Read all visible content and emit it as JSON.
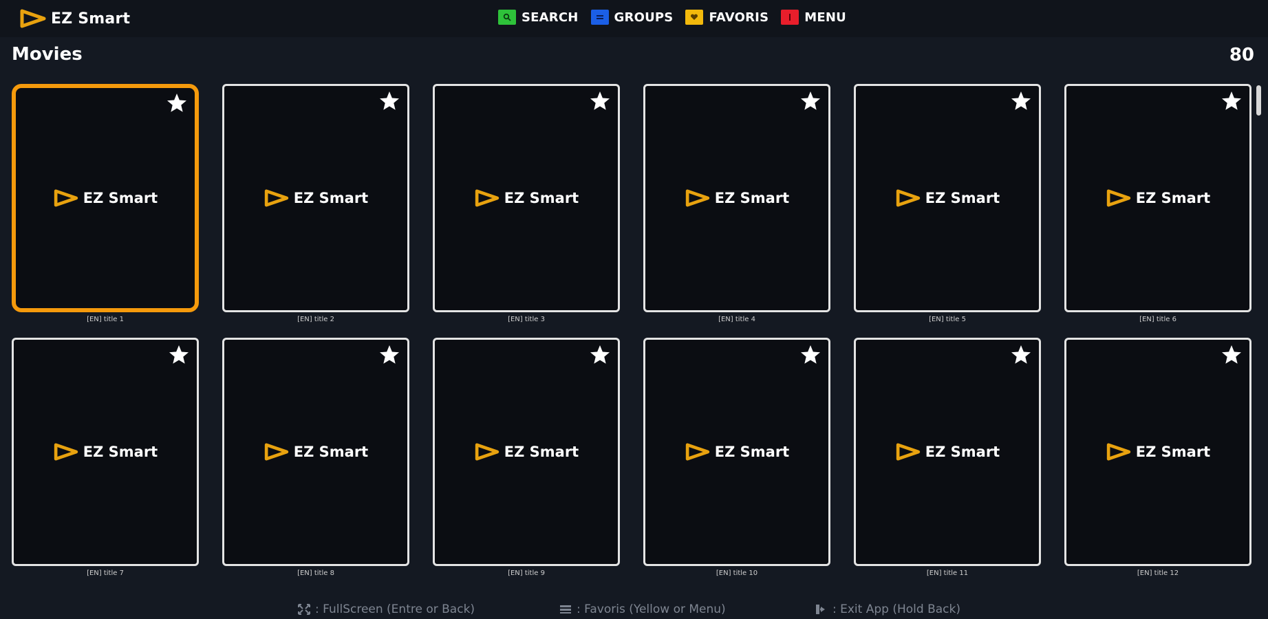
{
  "app": {
    "logo_text": "EZ Smart",
    "accent_color": "#f59a0c"
  },
  "nav": [
    {
      "label": "SEARCH",
      "key_color": "#2ec23a",
      "icon": "search-icon"
    },
    {
      "label": "GROUPS",
      "key_color": "#1b5fe6",
      "icon": "list-icon"
    },
    {
      "label": "FAVORIS",
      "key_color": "#f2b90c",
      "icon": "heart-icon"
    },
    {
      "label": "MENU",
      "key_color": "#e81e2b",
      "icon": "menu-icon"
    }
  ],
  "section": {
    "title": "Movies",
    "count": "80"
  },
  "movies": [
    {
      "title": "[EN] title 1",
      "poster_text": "EZ Smart",
      "focused": true
    },
    {
      "title": "[EN] title 2",
      "poster_text": "EZ Smart"
    },
    {
      "title": "[EN] title 3",
      "poster_text": "EZ Smart"
    },
    {
      "title": "[EN] title 4",
      "poster_text": "EZ Smart"
    },
    {
      "title": "[EN] title 5",
      "poster_text": "EZ Smart"
    },
    {
      "title": "[EN] title 6",
      "poster_text": "EZ Smart"
    },
    {
      "title": "[EN] title 7",
      "poster_text": "EZ Smart"
    },
    {
      "title": "[EN] title 8",
      "poster_text": "EZ Smart"
    },
    {
      "title": "[EN] title 9",
      "poster_text": "EZ Smart"
    },
    {
      "title": "[EN] title 10",
      "poster_text": "EZ Smart"
    },
    {
      "title": "[EN] title 11",
      "poster_text": "EZ Smart"
    },
    {
      "title": "[EN] title 12",
      "poster_text": "EZ Smart"
    }
  ],
  "footer": {
    "fullscreen": ": FullScreen (Entre or Back)",
    "favoris": ": Favoris (Yellow or Menu)",
    "exit": ": Exit App (Hold Back)"
  }
}
